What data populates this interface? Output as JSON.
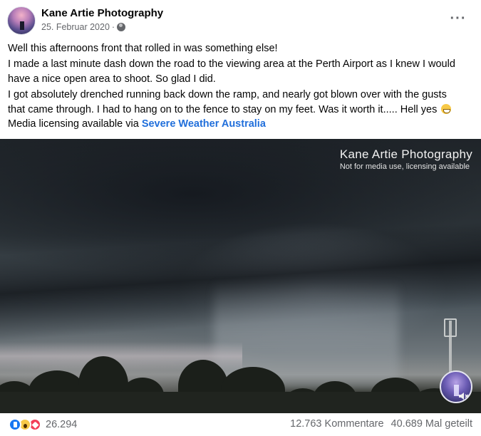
{
  "post": {
    "author": "Kane Artie Photography",
    "date": "25. Februar 2020",
    "separator": "·",
    "more_label": "···",
    "text_lines": [
      "Well this afternoons front that rolled in was something else!",
      "I made a last minute dash down the road to the viewing area at the Perth Airport as I knew I would",
      "have a nice open area to shoot. So glad I did.",
      "I got absolutely drenched running back down the ramp, and nearly got blown over with the gusts",
      "that came through. I had to hang on to the fence to stay on my feet. Was it worth it..... Hell yes"
    ],
    "licensing_prefix": "Media licensing available via",
    "licensing_link": "Severe Weather Australia"
  },
  "media": {
    "watermark_title": "Kane Artie Photography",
    "watermark_sub": "Not for media use, licensing available",
    "mute_icon": "speaker-muted-icon"
  },
  "footer": {
    "reaction_icons": [
      "like-icon",
      "wow-icon",
      "love-icon"
    ],
    "reaction_count": "26.294",
    "comments": "12.763 Kommentare",
    "shares": "40.689 Mal geteilt"
  },
  "colors": {
    "link": "#216fdb",
    "secondary_text": "#65676b",
    "like": "#1877f2",
    "love": "#f33e58",
    "wow": "#f7c948"
  }
}
